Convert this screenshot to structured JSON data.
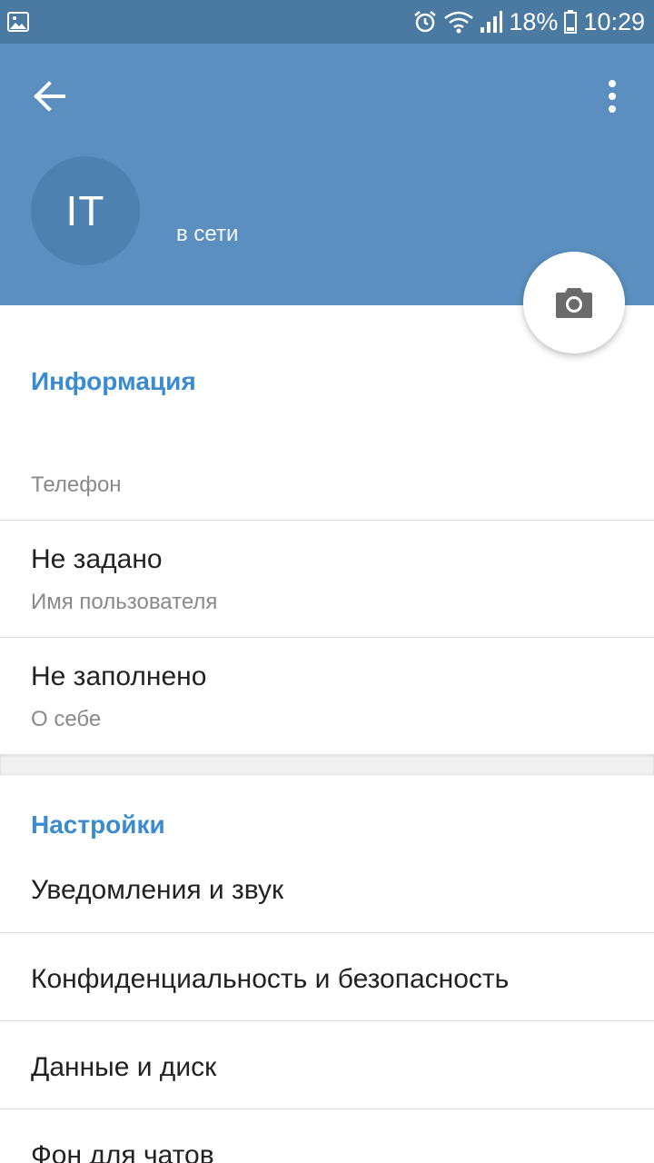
{
  "status_bar": {
    "battery": "18%",
    "time": "10:29",
    "icons": [
      "image-icon",
      "alarm-icon",
      "wifi-icon",
      "signal-icon",
      "battery-icon"
    ]
  },
  "header": {
    "avatar_initials": "IT",
    "status": "в сети",
    "background_color": "#5a8fbf"
  },
  "info": {
    "title": "Информация",
    "phone_label": "Телефон",
    "username_value": "Не задано",
    "username_label": "Имя пользователя",
    "about_value": "Не заполнено",
    "about_label": "О себе"
  },
  "settings": {
    "title": "Настройки",
    "items": [
      {
        "label": "Уведомления и звук"
      },
      {
        "label": "Конфиденциальность и безопасность"
      },
      {
        "label": "Данные и диск"
      },
      {
        "label": "Фон для чатов"
      }
    ]
  },
  "colors": {
    "accent": "#3a8bd0",
    "status_bar": "#4a79a2"
  }
}
